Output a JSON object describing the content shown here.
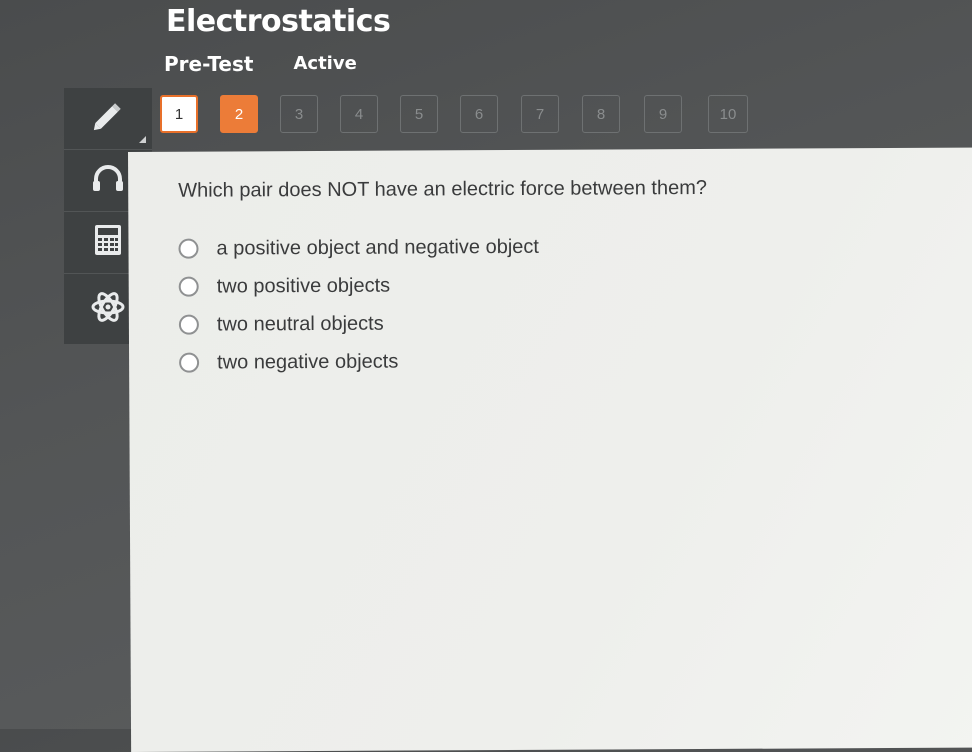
{
  "header": {
    "title": "Electrostatics",
    "subtitle": "Pre-Test",
    "status": "Active"
  },
  "question_nav": {
    "items": [
      {
        "label": "1",
        "state": "answered"
      },
      {
        "label": "2",
        "state": "current"
      },
      {
        "label": "3",
        "state": "unanswered"
      },
      {
        "label": "4",
        "state": "unanswered"
      },
      {
        "label": "5",
        "state": "unanswered"
      },
      {
        "label": "6",
        "state": "unanswered"
      },
      {
        "label": "7",
        "state": "unanswered"
      },
      {
        "label": "8",
        "state": "unanswered"
      },
      {
        "label": "9",
        "state": "unanswered"
      },
      {
        "label": "10",
        "state": "unanswered"
      }
    ],
    "colors": {
      "current": "#ec7c38",
      "answered_border": "#e8702a"
    }
  },
  "toolbar": {
    "tools": [
      {
        "icon": "pencil-icon"
      },
      {
        "icon": "headphones-icon"
      },
      {
        "icon": "calculator-icon"
      },
      {
        "icon": "atom-icon"
      }
    ]
  },
  "question": {
    "text": "Which pair does NOT have an electric force between them?",
    "options": [
      "a positive object and negative object",
      "two positive objects",
      "two neutral objects",
      "two negative objects"
    ]
  }
}
